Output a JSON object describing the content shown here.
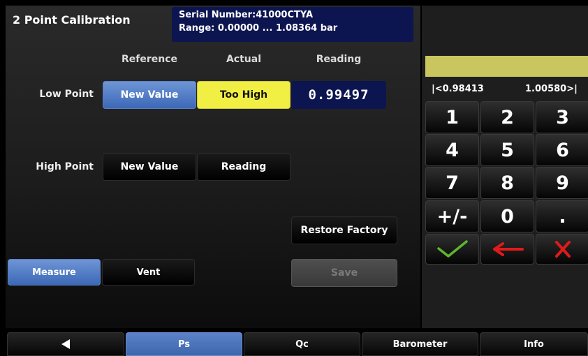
{
  "header": {
    "title": "2 Point Calibration",
    "serial": "Serial Number:41000CTYA",
    "range": "Range: 0.00000 ... 1.08364 bar"
  },
  "columns": {
    "reference": "Reference",
    "actual": "Actual",
    "reading": "Reading"
  },
  "low_point": {
    "label": "Low Point",
    "reference_button": "New Value",
    "actual_status": "Too High",
    "reading_value": "0.99497"
  },
  "high_point": {
    "label": "High Point",
    "reference_button": "New Value",
    "actual_button": "Reading"
  },
  "actions": {
    "restore_factory": "Restore Factory",
    "save": "Save",
    "measure": "Measure",
    "vent": "Vent"
  },
  "keypad": {
    "entry_value": "",
    "range_min": "|<0.98413",
    "range_max": "1.00580>|",
    "keys": [
      "1",
      "2",
      "3",
      "4",
      "5",
      "6",
      "7",
      "8",
      "9",
      "+/-",
      "0",
      "."
    ],
    "enter_icon": "checkmark-icon",
    "backspace_icon": "left-arrow-icon",
    "cancel_icon": "x-icon"
  },
  "nav": {
    "back_icon": "back-triangle-icon",
    "tabs": [
      "Ps",
      "Qc",
      "Barometer",
      "Info"
    ],
    "active_tab": "Ps"
  },
  "colors": {
    "accent_blue": "#4a74bf",
    "status_yellow": "#f1ef43",
    "reading_bg": "#0d1550",
    "entry_bg": "#c9c65f",
    "check_green": "#5fb62f",
    "arrow_red": "#e01a1a"
  }
}
